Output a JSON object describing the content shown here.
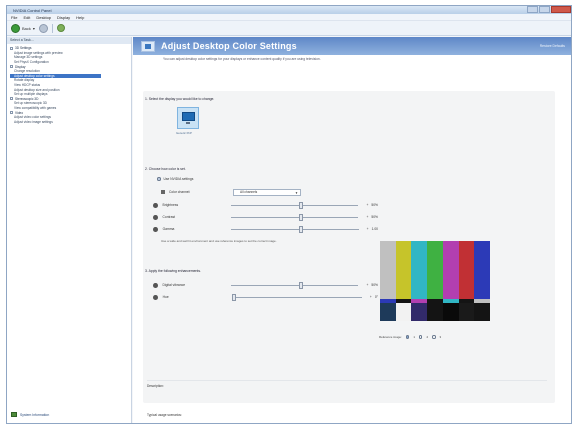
{
  "window": {
    "title": "NVIDIA Control Panel"
  },
  "menu": [
    "File",
    "Edit",
    "Desktop",
    "Display",
    "Help"
  ],
  "toolbar": {
    "back_label": "Back"
  },
  "sidebar": {
    "header": "Select a Task...",
    "items": [
      {
        "label": "3D Settings",
        "level": 0
      },
      {
        "label": "Adjust image settings with preview",
        "level": 1
      },
      {
        "label": "Manage 3D settings",
        "level": 1
      },
      {
        "label": "Set PhysX Configuration",
        "level": 1
      },
      {
        "label": "Display",
        "level": 0
      },
      {
        "label": "Change resolution",
        "level": 1
      },
      {
        "label": "Adjust desktop color settings",
        "level": 1,
        "selected": true
      },
      {
        "label": "Rotate display",
        "level": 1
      },
      {
        "label": "View HDCP status",
        "level": 1
      },
      {
        "label": "Adjust desktop size and position",
        "level": 1
      },
      {
        "label": "Set up multiple displays",
        "level": 1
      },
      {
        "label": "Stereoscopic 3D",
        "level": 0
      },
      {
        "label": "Set up stereoscopic 3D",
        "level": 1
      },
      {
        "label": "View compatibility with games",
        "level": 1
      },
      {
        "label": "Video",
        "level": 0
      },
      {
        "label": "Adjust video color settings",
        "level": 1
      },
      {
        "label": "Adjust video image settings",
        "level": 1
      }
    ],
    "footer_link": "System Information"
  },
  "page": {
    "title": "Adjust Desktop Color Settings",
    "restore_label": "Restore Defaults",
    "description": "You can adjust desktop color settings for your displays or enhance content quality if you are using television.",
    "step1": "1. Select the display you would like to change.",
    "display_name": "Generic PnP",
    "step2": "2. Choose how color is set.",
    "radio_nvidia": "Use NVIDIA settings",
    "color_channel_label": "Color channel:",
    "color_channel_value": "All channels",
    "sliders": [
      {
        "label": "Brightness",
        "sign": "+",
        "value": "50%",
        "position": 0.5
      },
      {
        "label": "Contrast",
        "sign": "+",
        "value": "50%",
        "position": 0.5
      },
      {
        "label": "Gamma",
        "sign": "+",
        "value": "1.00",
        "position": 0.5
      }
    ],
    "slider_note": "Use a wide and well lit environment and use reference images to set the correct image.",
    "step3": "3. Apply the following enhancements.",
    "enh_sliders": [
      {
        "label": "Digital vibrance",
        "sign": "+",
        "value": "50%",
        "position": 0.5
      },
      {
        "label": "Hue",
        "sign": "+",
        "value": "0°",
        "position": 0.0
      }
    ],
    "reference_mode_label": "Reference image:",
    "reference_options": [
      "1",
      "2",
      "3"
    ],
    "description_label": "Description:",
    "typical_usage_label": "Typical usage scenarios:"
  },
  "colors": {
    "accent": "#3d74c6",
    "bars_top": [
      "#c0c0c0",
      "#c6c42a",
      "#31b6c4",
      "#3fb142",
      "#b23fb0",
      "#c13034",
      "#2c3ab7"
    ],
    "bars_mid": [
      "#2c3ab7",
      "#141414",
      "#b23fb0",
      "#141414",
      "#31b6c4",
      "#141414",
      "#c0c0c0"
    ],
    "bars_bot": [
      "#1e3a5a",
      "#f2f2f2",
      "#322a6a",
      "#141414",
      "#0a0a0a",
      "#1a1a1a",
      "#141414"
    ]
  }
}
